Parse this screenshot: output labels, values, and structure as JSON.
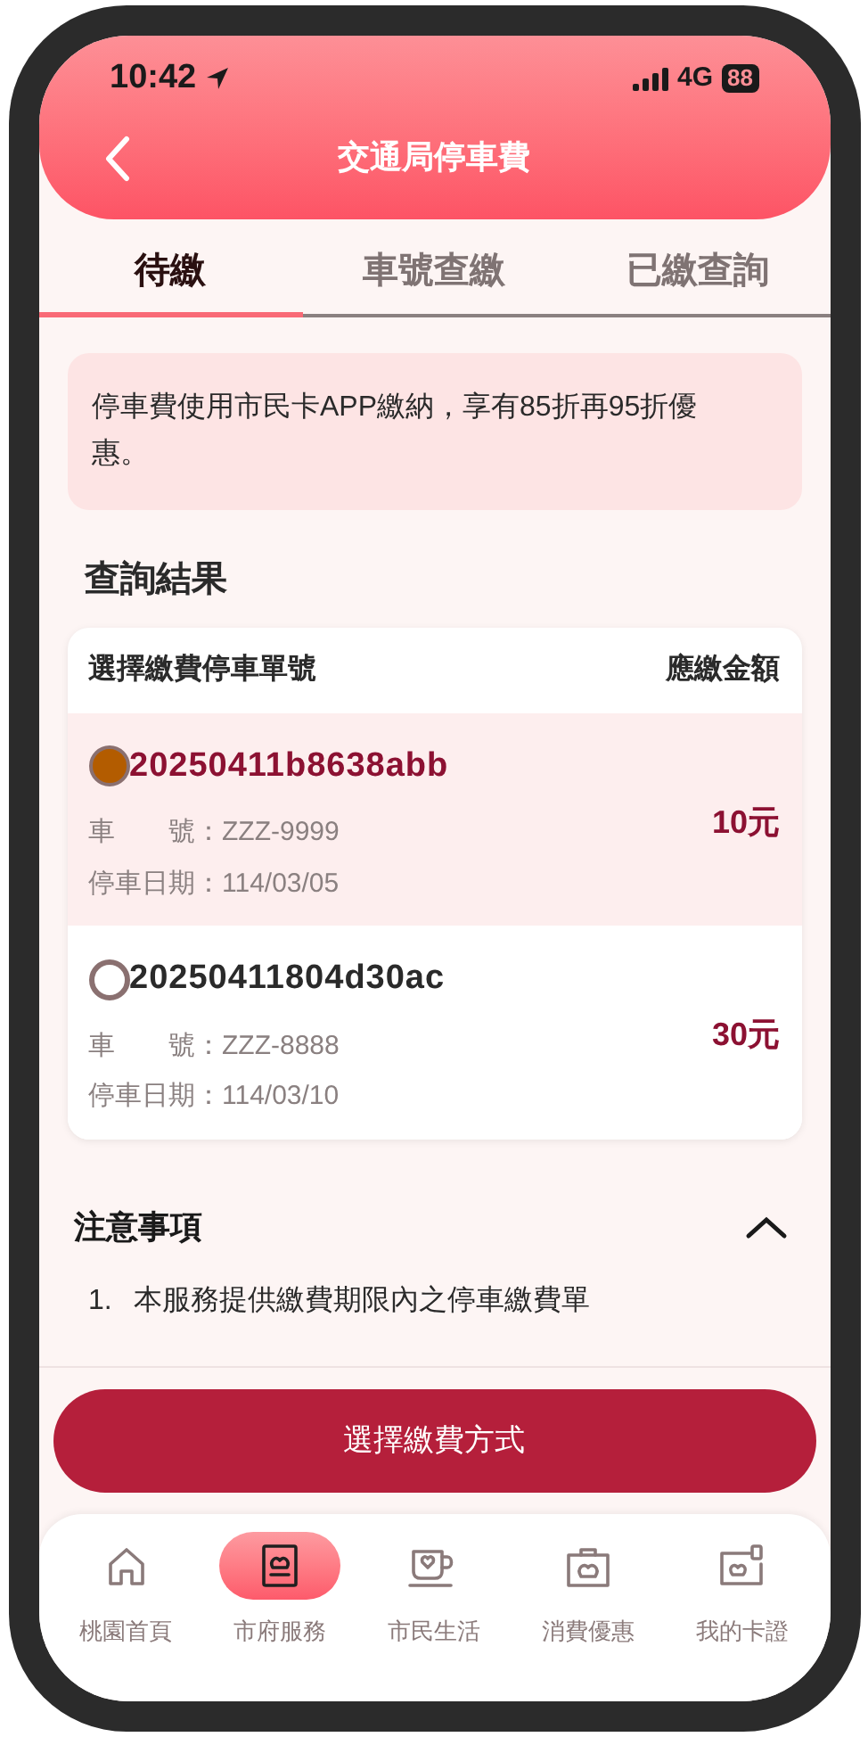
{
  "status_bar": {
    "time": "10:42",
    "network": "4G",
    "battery": "88"
  },
  "header": {
    "title": "交通局停車費"
  },
  "tabs": [
    {
      "label": "待繳",
      "selected": true
    },
    {
      "label": "車號查繳",
      "selected": false
    },
    {
      "label": "已繳查詢",
      "selected": false
    }
  ],
  "notice": "停車費使用市民卡APP繳納，享有85折再95折優惠。",
  "results": {
    "title": "查詢結果",
    "columns": [
      "選擇繳費停車單號",
      "應繳金額"
    ],
    "rows": [
      {
        "ticket": "20250411b8638abb",
        "plate_label": "車號",
        "plate": "：ZZZ-9999",
        "date_label": "停車日期",
        "date": "：114/03/05",
        "amount": "10元",
        "selected": true
      },
      {
        "ticket": "20250411804d30ac",
        "plate_label": "車號",
        "plate": "：ZZZ-8888",
        "date_label": "停車日期",
        "date": "：114/03/10",
        "amount": "30元",
        "selected": false
      }
    ]
  },
  "notes": {
    "title": "注意事項",
    "expanded": true,
    "items": [
      {
        "number": "1.",
        "text": "本服務提供繳費期限內之停車繳費單"
      }
    ]
  },
  "action": {
    "label": "選擇繳費方式"
  },
  "nav": [
    {
      "kind": "home",
      "label": "桃園首頁",
      "selected": false
    },
    {
      "kind": "service",
      "label": "市府服務",
      "selected": true
    },
    {
      "kind": "life",
      "label": "市民生活",
      "selected": false
    },
    {
      "kind": "offer",
      "label": "消費優惠",
      "selected": false
    },
    {
      "kind": "card",
      "label": "我的卡證",
      "selected": false
    }
  ]
}
